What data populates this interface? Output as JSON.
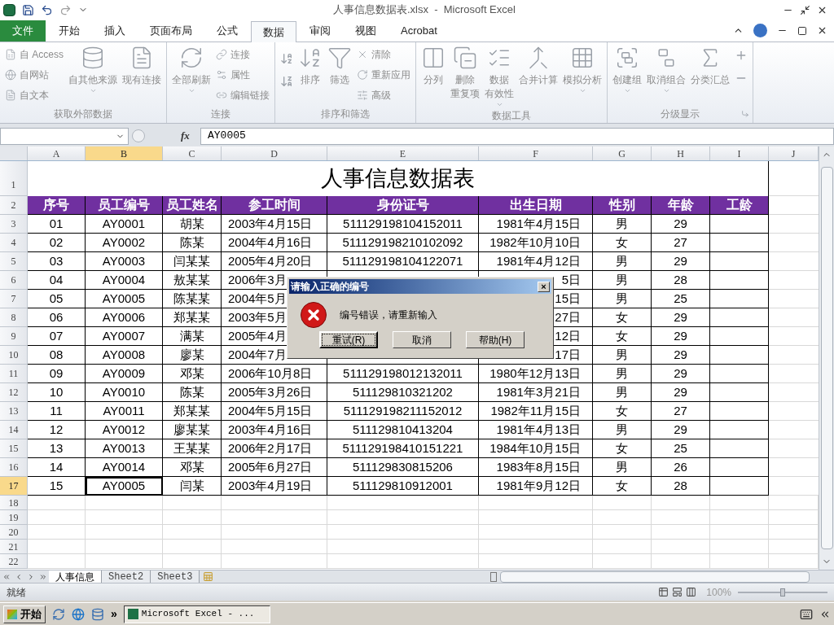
{
  "title_bar": {
    "title": "人事信息数据表.xlsx  -  Microsoft Excel"
  },
  "ribbon_tabs": [
    {
      "label": "文件",
      "kind": "file",
      "selected": false
    },
    {
      "label": "开始",
      "kind": "tab",
      "selected": false
    },
    {
      "label": "插入",
      "kind": "tab",
      "selected": false
    },
    {
      "label": "页面布局",
      "kind": "tab",
      "selected": false
    },
    {
      "label": "公式",
      "kind": "tab",
      "selected": false
    },
    {
      "label": "数据",
      "kind": "tab",
      "selected": true
    },
    {
      "label": "审阅",
      "kind": "tab",
      "selected": false
    },
    {
      "label": "视图",
      "kind": "tab",
      "selected": false
    },
    {
      "label": "Acrobat",
      "kind": "tab",
      "selected": false
    }
  ],
  "ribbon": {
    "disabled": true,
    "groups": [
      {
        "label": "获取外部数据",
        "items": [
          {
            "kind": "small",
            "entries": [
              "自 Access",
              "自网站",
              "自文本"
            ]
          },
          {
            "kind": "large",
            "lines": [
              "自其他来源"
            ],
            "dropdown": true
          },
          {
            "kind": "large",
            "lines": [
              "现有连接"
            ]
          }
        ]
      },
      {
        "label": "连接",
        "items": [
          {
            "kind": "large",
            "lines": [
              "全部刷新"
            ],
            "dropdown": true
          },
          {
            "kind": "small",
            "entries": [
              "连接",
              "属性",
              "编辑链接"
            ]
          }
        ]
      },
      {
        "label": "排序和筛选",
        "items": [
          {
            "kind": "sort_pair"
          },
          {
            "kind": "large",
            "lines": [
              "排序"
            ]
          },
          {
            "kind": "large",
            "lines": [
              "筛选"
            ]
          },
          {
            "kind": "small",
            "entries": [
              "清除",
              "重新应用",
              "高级"
            ]
          }
        ]
      },
      {
        "label": "数据工具",
        "items": [
          {
            "kind": "large",
            "lines": [
              "分列"
            ]
          },
          {
            "kind": "large",
            "lines": [
              "删除",
              "重复项"
            ]
          },
          {
            "kind": "large",
            "lines": [
              "数据",
              "有效性"
            ],
            "dropdown": true
          },
          {
            "kind": "large",
            "lines": [
              "合并计算"
            ]
          },
          {
            "kind": "large",
            "lines": [
              "模拟分析"
            ],
            "dropdown": true
          }
        ]
      },
      {
        "label": "分级显示",
        "launcher": true,
        "items": [
          {
            "kind": "large",
            "lines": [
              "创建组"
            ],
            "dropdown": true
          },
          {
            "kind": "large",
            "lines": [
              "取消组合"
            ],
            "dropdown": true
          },
          {
            "kind": "large",
            "lines": [
              "分类汇总"
            ]
          },
          {
            "kind": "outline_pair"
          }
        ]
      }
    ]
  },
  "formula_bar": {
    "fx": "fx",
    "value": "AY0005"
  },
  "sheet": {
    "columns": [
      {
        "label": "A",
        "selected": false
      },
      {
        "label": "B",
        "selected": true
      },
      {
        "label": "C",
        "selected": false
      },
      {
        "label": "D",
        "selected": false
      },
      {
        "label": "E",
        "selected": false
      },
      {
        "label": "F",
        "selected": false
      },
      {
        "label": "G",
        "selected": false
      },
      {
        "label": "H",
        "selected": false
      },
      {
        "label": "I",
        "selected": false
      },
      {
        "label": "J",
        "selected": false
      }
    ],
    "title_row": {
      "number": "1",
      "text": "人事信息数据表"
    },
    "header_row": {
      "number": "2",
      "labels": [
        "序号",
        "员工编号",
        "员工姓名",
        "参工时间",
        "身份证号",
        "出生日期",
        "性别",
        "年龄",
        "工龄"
      ]
    },
    "rows": [
      {
        "number": "3",
        "selected": false,
        "seq": "01",
        "id": "AY0001",
        "name": "胡某",
        "start": "2003年4月15日",
        "id_card": "511129198104152011",
        "birth": "1981年4月15日",
        "gender": "男",
        "age": "29"
      },
      {
        "number": "4",
        "selected": false,
        "seq": "02",
        "id": "AY0002",
        "name": "陈某",
        "start": "2004年4月16日",
        "id_card": "511129198210102092",
        "birth": "1982年10月10日",
        "gender": "女",
        "age": "27"
      },
      {
        "number": "5",
        "selected": false,
        "seq": "03",
        "id": "AY0003",
        "name": "闫某某",
        "start": "2005年4月20日",
        "id_card": "511129198104122071",
        "birth": "1981年4月12日",
        "gender": "男",
        "age": "29"
      },
      {
        "number": "6",
        "selected": false,
        "seq": "04",
        "id": "AY0004",
        "name": "敖某某",
        "start": "2006年3月",
        "birth": "5日",
        "gender": "男",
        "age": "28"
      },
      {
        "number": "7",
        "selected": false,
        "seq": "05",
        "id": "AY0005",
        "name": "陈某某",
        "start": "2004年5月",
        "birth": "15日",
        "gender": "男",
        "age": "25"
      },
      {
        "number": "8",
        "selected": false,
        "seq": "06",
        "id": "AY0006",
        "name": "郑某某",
        "start": "2003年5月",
        "birth": "27日",
        "gender": "女",
        "age": "29"
      },
      {
        "number": "9",
        "selected": false,
        "seq": "07",
        "id": "AY0007",
        "name": "满某",
        "start": "2005年4月",
        "birth": "12日",
        "gender": "女",
        "age": "29"
      },
      {
        "number": "10",
        "selected": false,
        "seq": "08",
        "id": "AY0008",
        "name": "廖某",
        "start": "2004年7月",
        "birth": "17日",
        "gender": "男",
        "age": "29"
      },
      {
        "number": "11",
        "selected": false,
        "seq": "09",
        "id": "AY0009",
        "name": "邓某",
        "start": "2006年10月8日",
        "id_card": "511129198012132011",
        "birth": "1980年12月13日",
        "gender": "男",
        "age": "29"
      },
      {
        "number": "12",
        "selected": false,
        "seq": "10",
        "id": "AY0010",
        "name": "陈某",
        "start": "2005年3月26日",
        "id_card": "511129810321202",
        "birth": "1981年3月21日",
        "gender": "男",
        "age": "29"
      },
      {
        "number": "13",
        "selected": false,
        "seq": "11",
        "id": "AY0011",
        "name": "郑某某",
        "start": "2004年5月15日",
        "id_card": "511129198211152012",
        "birth": "1982年11月15日",
        "gender": "女",
        "age": "27"
      },
      {
        "number": "14",
        "selected": false,
        "seq": "12",
        "id": "AY0012",
        "name": "廖某某",
        "start": "2003年4月16日",
        "id_card": "511129810413204",
        "birth": "1981年4月13日",
        "gender": "男",
        "age": "29"
      },
      {
        "number": "15",
        "selected": false,
        "seq": "13",
        "id": "AY0013",
        "name": "王某某",
        "start": "2006年2月17日",
        "id_card": "511129198410151221",
        "birth": "1984年10月15日",
        "gender": "女",
        "age": "25"
      },
      {
        "number": "16",
        "selected": false,
        "seq": "14",
        "id": "AY0014",
        "name": "邓某",
        "start": "2005年6月27日",
        "id_card": "511129830815206",
        "birth": "1983年8月15日",
        "gender": "男",
        "age": "26"
      },
      {
        "number": "17",
        "selected": true,
        "seq": "15",
        "id": "AY0005",
        "name": "闫某",
        "start": "2003年4月19日",
        "id_card": "511129810912001",
        "birth": "1981年9月12日",
        "gender": "女",
        "age": "28"
      }
    ],
    "empty_rows": [
      "18",
      "19",
      "20",
      "21",
      "22"
    ]
  },
  "dialog": {
    "title": "请输入正确的编号",
    "message": "编号错误，请重新输入",
    "close": "×",
    "buttons": [
      {
        "label": "重试(R)",
        "focused": true
      },
      {
        "label": "取消",
        "focused": false
      },
      {
        "label": "帮助(H)",
        "focused": false
      }
    ]
  },
  "sheet_tabs": [
    {
      "label": "人事信息",
      "selected": true
    },
    {
      "label": "Sheet2",
      "selected": false
    },
    {
      "label": "Sheet3",
      "selected": false
    }
  ],
  "status_bar": {
    "status": "就绪",
    "zoom": "100%",
    "zoom_slider": {
      "level": 0.5
    }
  },
  "taskbar": {
    "start": "开始",
    "more": "»",
    "tasks": [
      {
        "label": "Microsoft Excel - ...",
        "selected": true
      }
    ]
  }
}
